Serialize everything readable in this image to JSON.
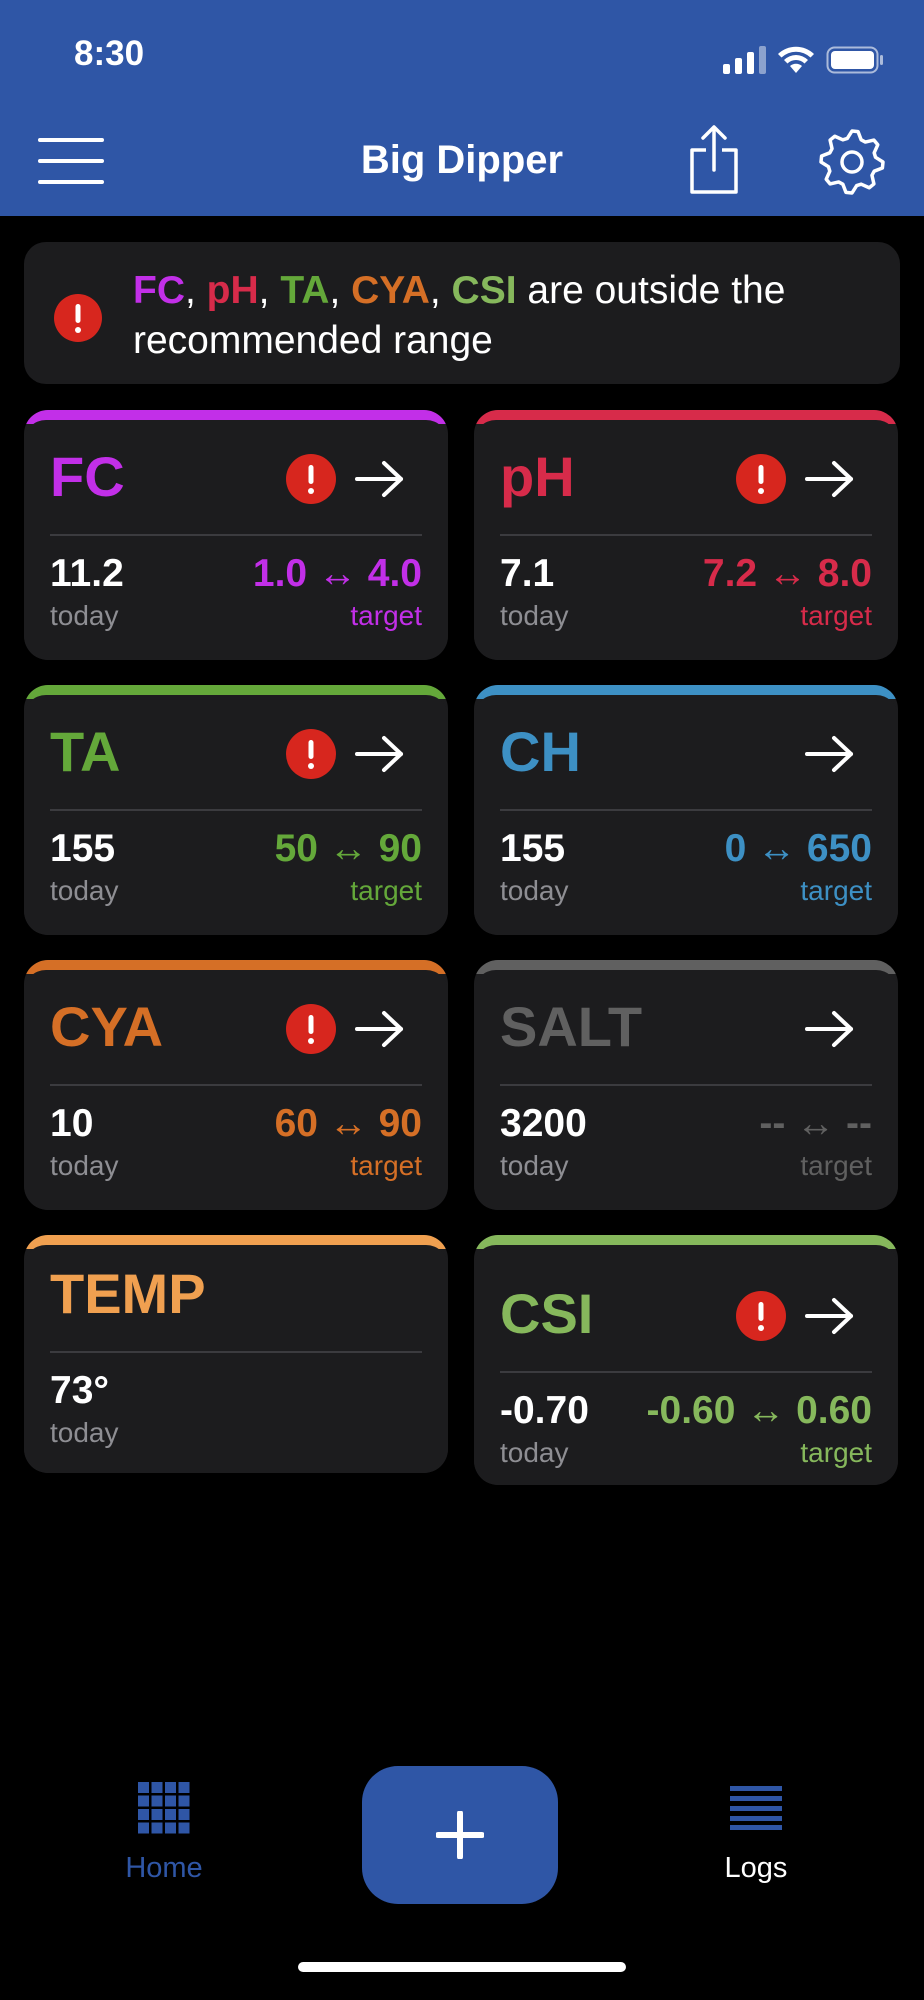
{
  "status_bar": {
    "time": "8:30"
  },
  "header": {
    "title": "Big Dipper"
  },
  "alert": {
    "flagged": [
      {
        "label": "FC",
        "color": "#c22fe8"
      },
      {
        "label": "pH",
        "color": "#d72b4a"
      },
      {
        "label": "TA",
        "color": "#64a83a"
      },
      {
        "label": "CYA",
        "color": "#d56f26"
      },
      {
        "label": "CSI",
        "color": "#86b85c"
      }
    ],
    "separator": ", ",
    "message": " are outside the recommended range"
  },
  "cards": [
    {
      "name": "FC",
      "color": "#c22fe8",
      "warning": true,
      "has_arrow": true,
      "value": "11.2",
      "value_label": "today",
      "range": "1.0 ↔ 4.0",
      "range_label": "target"
    },
    {
      "name": "pH",
      "color": "#d72b4a",
      "warning": true,
      "has_arrow": true,
      "value": "7.1",
      "value_label": "today",
      "range": "7.2 ↔ 8.0",
      "range_label": "target"
    },
    {
      "name": "TA",
      "color": "#64a83a",
      "warning": true,
      "has_arrow": true,
      "value": "155",
      "value_label": "today",
      "range": "50 ↔ 90",
      "range_label": "target"
    },
    {
      "name": "CH",
      "color": "#3d90c4",
      "warning": false,
      "has_arrow": true,
      "value": "155",
      "value_label": "today",
      "range": "0 ↔ 650",
      "range_label": "target"
    },
    {
      "name": "CYA",
      "color": "#d56f26",
      "warning": true,
      "has_arrow": true,
      "value": "10",
      "value_label": "today",
      "range": "60 ↔ 90",
      "range_label": "target"
    },
    {
      "name": "SALT",
      "color": "#606060",
      "warning": false,
      "has_arrow": true,
      "value": "3200",
      "value_label": "today",
      "range": "-- ↔ --",
      "range_label": "target"
    },
    {
      "name": "TEMP",
      "color": "#f0a050",
      "warning": false,
      "has_arrow": false,
      "value": "73°",
      "value_label": "today",
      "range": "",
      "range_label": ""
    },
    {
      "name": "CSI",
      "color": "#86b85c",
      "warning": true,
      "has_arrow": true,
      "value": "-0.70",
      "value_label": "today",
      "range": "-0.60 ↔ 0.60",
      "range_label": "target"
    }
  ],
  "tab_bar": {
    "home_label": "Home",
    "logs_label": "Logs",
    "home_icon": "grid-icon",
    "logs_icon": "list-icon",
    "add_icon": "plus-icon"
  },
  "colors": {
    "accent": "#2f56a6",
    "warning": "#d7261e",
    "card": "#1c1c1e"
  }
}
